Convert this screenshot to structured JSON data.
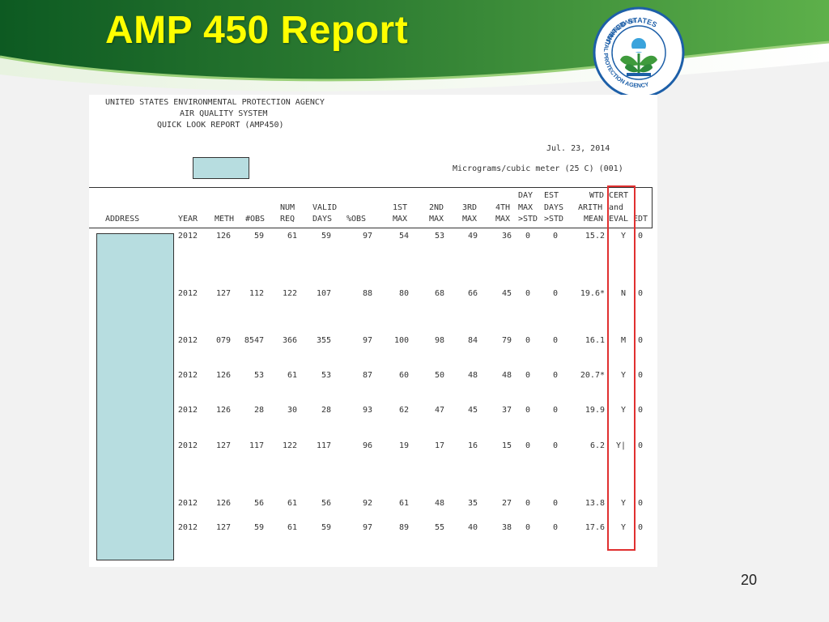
{
  "slide": {
    "title": "AMP 450 Report",
    "page_number": "20"
  },
  "logo": {
    "icon": "epa-seal-icon",
    "top_text": "UNITED STATES",
    "ring_text": "ENVIRONMENTAL PROTECTION AGENCY"
  },
  "report": {
    "agency": "UNITED STATES ENVIRONMENTAL PROTECTION AGENCY",
    "system": "AIR QUALITY SYSTEM",
    "report_name": "QUICK LOOK REPORT (AMP450)",
    "date": "Jul. 23, 2014",
    "units": "Micrograms/cubic meter (25 C) (001)"
  },
  "table": {
    "headers": {
      "address": "ADDRESS",
      "year": "YEAR",
      "meth": "METH",
      "obs": "#OBS",
      "num_req": [
        "NUM",
        "REQ"
      ],
      "valid_days": [
        "VALID",
        "DAYS"
      ],
      "pct_obs": "%OBS",
      "max1": [
        "1ST",
        "MAX"
      ],
      "max2": [
        "2ND",
        "MAX"
      ],
      "max3": [
        "3RD",
        "MAX"
      ],
      "max4": [
        "4TH",
        "MAX"
      ],
      "day_max_std": [
        "DAY",
        "MAX",
        ">STD"
      ],
      "est_days_std": [
        "EST",
        "DAYS",
        ">STD"
      ],
      "wtd_arith_mean": [
        "WTD",
        "ARITH",
        "MEAN"
      ],
      "cert_eval": [
        "CERT",
        "and",
        "EVAL"
      ],
      "edt": "EDT"
    },
    "rows": [
      {
        "year": "2012",
        "meth": "126",
        "obs": "59",
        "req": "61",
        "valid": "59",
        "pct": "97",
        "m1": "54",
        "m2": "53",
        "m3": "49",
        "m4": "36",
        "day": "0",
        "est": "0",
        "mean": "15.2",
        "cert": "Y",
        "edt": "0"
      },
      {
        "year": "2012",
        "meth": "127",
        "obs": "112",
        "req": "122",
        "valid": "107",
        "pct": "88",
        "m1": "80",
        "m2": "68",
        "m3": "66",
        "m4": "45",
        "day": "0",
        "est": "0",
        "mean": "19.6*",
        "cert": "N",
        "edt": "0"
      },
      {
        "year": "2012",
        "meth": "079",
        "obs": "8547",
        "req": "366",
        "valid": "355",
        "pct": "97",
        "m1": "100",
        "m2": "98",
        "m3": "84",
        "m4": "79",
        "day": "0",
        "est": "0",
        "mean": "16.1",
        "cert": "M",
        "edt": "0"
      },
      {
        "year": "2012",
        "meth": "126",
        "obs": "53",
        "req": "61",
        "valid": "53",
        "pct": "87",
        "m1": "60",
        "m2": "50",
        "m3": "48",
        "m4": "48",
        "day": "0",
        "est": "0",
        "mean": "20.7*",
        "cert": "Y",
        "edt": "0"
      },
      {
        "year": "2012",
        "meth": "126",
        "obs": "28",
        "req": "30",
        "valid": "28",
        "pct": "93",
        "m1": "62",
        "m2": "47",
        "m3": "45",
        "m4": "37",
        "day": "0",
        "est": "0",
        "mean": "19.9",
        "cert": "Y",
        "edt": "0"
      },
      {
        "year": "2012",
        "meth": "127",
        "obs": "117",
        "req": "122",
        "valid": "117",
        "pct": "96",
        "m1": "19",
        "m2": "17",
        "m3": "16",
        "m4": "15",
        "day": "0",
        "est": "0",
        "mean": "6.2",
        "cert": "Y|",
        "edt": "0"
      },
      {
        "year": "2012",
        "meth": "126",
        "obs": "56",
        "req": "61",
        "valid": "56",
        "pct": "92",
        "m1": "61",
        "m2": "48",
        "m3": "35",
        "m4": "27",
        "day": "0",
        "est": "0",
        "mean": "13.8",
        "cert": "Y",
        "edt": "0"
      },
      {
        "year": "2012",
        "meth": "127",
        "obs": "59",
        "req": "61",
        "valid": "59",
        "pct": "97",
        "m1": "89",
        "m2": "55",
        "m3": "40",
        "m4": "38",
        "day": "0",
        "est": "0",
        "mean": "17.6",
        "cert": "Y",
        "edt": "0"
      }
    ]
  },
  "colors": {
    "title": "#ffff00",
    "banner_dark": "#0d5a22",
    "banner_mid": "#3f9b3c",
    "redaction": "#b7dde0",
    "highlight_box": "#e03030",
    "epa_blue": "#1d5fa8"
  }
}
